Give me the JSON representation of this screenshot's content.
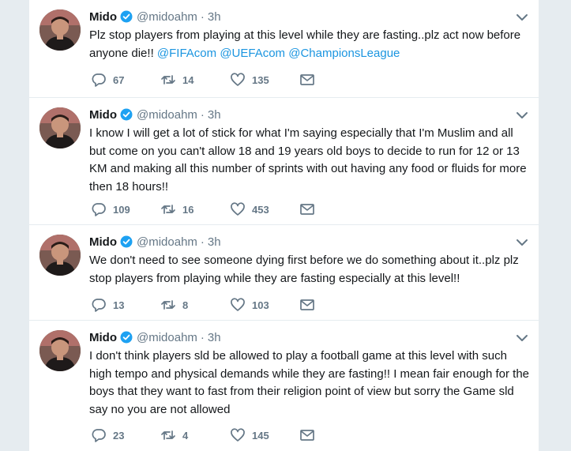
{
  "tweets": [
    {
      "name": "Mido",
      "handle": "@midoahm",
      "separator": "·",
      "time": "3h",
      "text_parts": [
        "Plz stop players from playing at this level while they are fasting..plz act now before anyone die!! ",
        "@FIFAcom",
        " ",
        "@UEFAcom",
        " ",
        "@ChampionsLeague"
      ],
      "replies": "67",
      "retweets": "14",
      "likes": "135"
    },
    {
      "name": "Mido",
      "handle": "@midoahm",
      "separator": "·",
      "time": "3h",
      "text": "I know I will get a lot of stick for what I'm saying especially that I'm Muslim and all but come on you can't allow 18 and 19 years old boys to decide to run for 12 or 13 KM and making all this number of sprints with out having any food or fluids for more then 18 hours!!",
      "replies": "109",
      "retweets": "16",
      "likes": "453"
    },
    {
      "name": "Mido",
      "handle": "@midoahm",
      "separator": "·",
      "time": "3h",
      "text": "We don't need to see someone dying first before we do something about it..plz plz stop players from playing while they are fasting especially at this level!!",
      "replies": "13",
      "retweets": "8",
      "likes": "103"
    },
    {
      "name": "Mido",
      "handle": "@midoahm",
      "separator": "·",
      "time": "3h",
      "text": "I don't think players sld be allowed to play a football game at this level with such high tempo and physical demands while they are fasting!! I mean fair enough for the boys that they want to fast from their religion point of view but sorry the Game sld say no you are not allowed",
      "replies": "23",
      "retweets": "4",
      "likes": "145"
    }
  ],
  "icons": {
    "reply": "reply-icon",
    "retweet": "retweet-icon",
    "like": "heart-icon",
    "dm": "envelope-icon",
    "verified": "verified-badge-icon",
    "menu": "chevron-down-icon"
  },
  "colors": {
    "accent": "#1da1f2",
    "mention": "#1b95e0",
    "muted": "#657786",
    "text": "#14171a"
  }
}
